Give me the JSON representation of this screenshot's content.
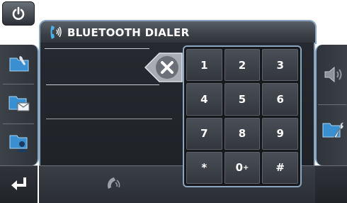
{
  "header": {
    "title": "BLUETOOTH DIALER"
  },
  "keypad": {
    "keys": [
      {
        "label": "1"
      },
      {
        "label": "2"
      },
      {
        "label": "3"
      },
      {
        "label": "4"
      },
      {
        "label": "5"
      },
      {
        "label": "6"
      },
      {
        "label": "7"
      },
      {
        "label": "8"
      },
      {
        "label": "9"
      },
      {
        "label": "*"
      },
      {
        "label": "0"
      },
      {
        "label": "#"
      }
    ],
    "zero_sub": "+"
  },
  "icons": {
    "power": "power-icon",
    "bluetooth": "bluetooth-phone-icon",
    "left": [
      "phonebook-icon",
      "messages-icon",
      "contacts-icon"
    ],
    "back": "back-enter-icon",
    "delete": "delete-icon",
    "speaker": "speaker-icon",
    "settings": "settings-icon",
    "call": "call-icon"
  },
  "colors": {
    "accent": "#8aa6c0",
    "panel": "#3a3f46",
    "bluetooth": "#4ab0e8"
  }
}
